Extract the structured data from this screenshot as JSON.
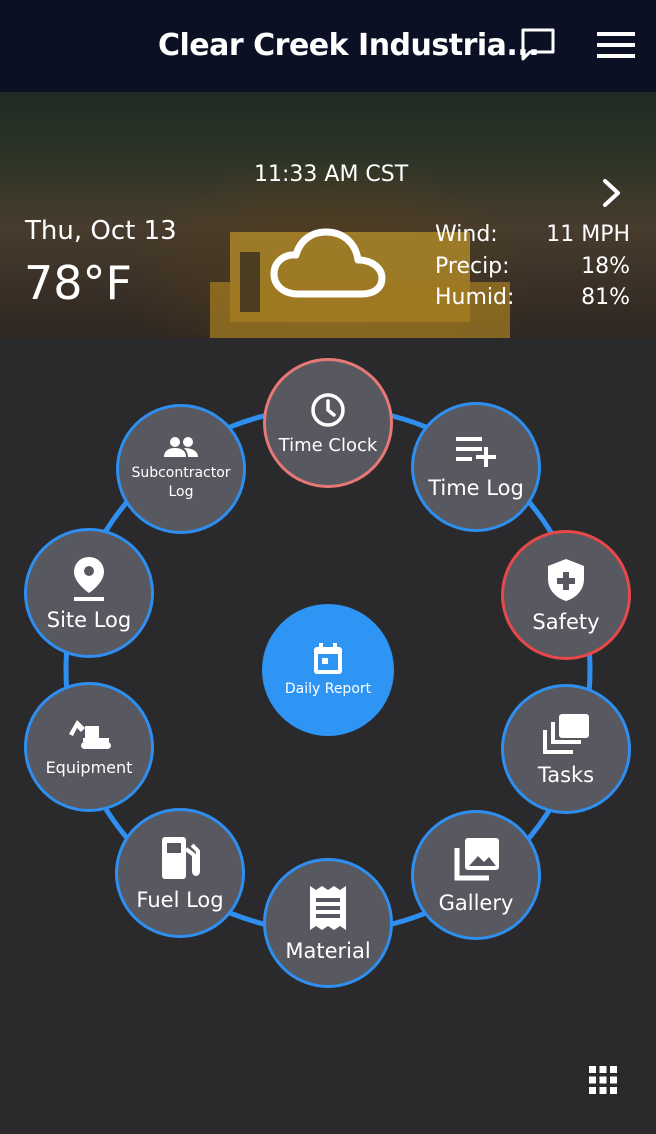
{
  "header": {
    "title": "Clear Creek Industria...",
    "icons": [
      "chat-icon",
      "menu-icon"
    ]
  },
  "weather": {
    "time": "11:33 AM CST",
    "date": "Thu, Oct 13",
    "temperature": "78°F",
    "condition_icon": "cloud-icon",
    "wind_label": "Wind:",
    "wind_value": "11 MPH",
    "precip_label": "Precip:",
    "precip_value": "18%",
    "humid_label": "Humid:",
    "humid_value": "81%"
  },
  "menu": {
    "center_label": "Daily Report",
    "time_clock": "Time Clock",
    "time_log": "Time Log",
    "safety": "Safety",
    "tasks": "Tasks",
    "gallery": "Gallery",
    "material": "Material",
    "fuel_log": "Fuel Log",
    "equipment": "Equipment",
    "site_log": "Site Log",
    "subcontractor_log": "Subcontractor Log"
  },
  "colors": {
    "accent_blue": "#2e8ff0",
    "alert_red": "#e8484a",
    "clock_red": "#e67876",
    "node_bg": "#585860"
  }
}
